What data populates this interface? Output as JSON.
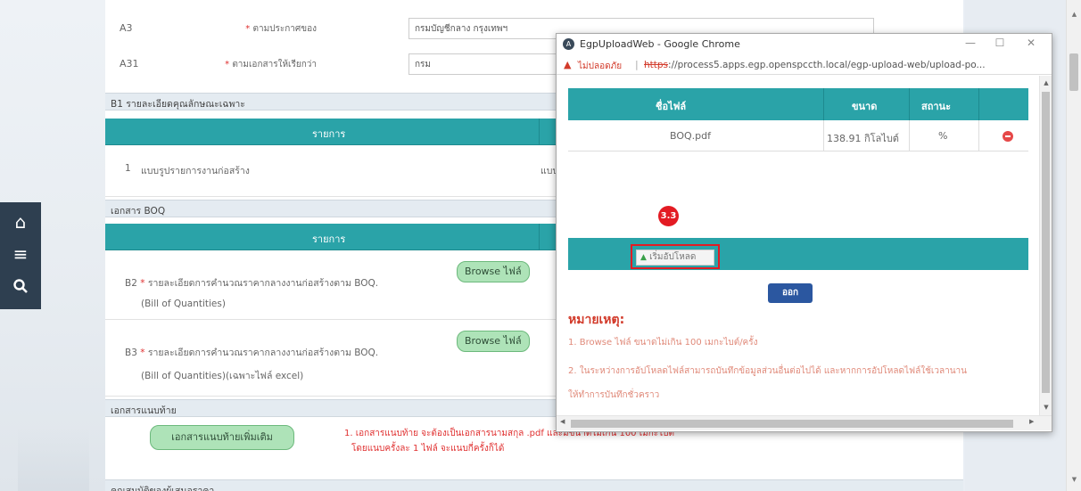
{
  "sidebar": {
    "icons": [
      "home-icon",
      "menu-icon",
      "search-icon"
    ]
  },
  "form": {
    "fields": [
      {
        "code": "A3",
        "label": "ตามประกาศของ",
        "value": "กรมบัญชีกลาง กรุงเทพฯ"
      },
      {
        "code": "A31",
        "label": "ตามเอกสารให้เรียกว่า",
        "value": "กรม"
      }
    ],
    "section_b1": "B1 รายละเอียดคุณลักษณะเฉพาะ",
    "table_header_item": "รายการ",
    "b1_row": {
      "num": "1",
      "text": "แบบรูปรายการงานก่อสร้าง",
      "right_text": "แบบ"
    },
    "section_boq": "เอกสาร BOQ",
    "boq_header_item": "รายการ",
    "b2": {
      "code": "B2",
      "text": "รายละเอียดการคำนวณราคากลางงานก่อสร้างตาม BOQ.",
      "sub": "(Bill of Quantities)",
      "browse": "Browse ไฟล์"
    },
    "b3": {
      "code": "B3",
      "text": "รายละเอียดการคำนวณราคากลางงานก่อสร้างตาม BOQ.",
      "sub": "(Bill of Quantities)(เฉพาะไฟล์ excel)",
      "browse": "Browse ไฟล์"
    },
    "section_attach": "เอกสารแนบท้าย",
    "attach_button": "เอกสารแนบท้ายเพิ่มเติม",
    "attach_note_line1": "1. เอกสารแนบท้าย จะต้องเป็นเอกสารนามสกุล .pdf และมีขนาดไม่เกิน 100 เมกะไบต์",
    "attach_note_line2": "โดยแนบครั้งละ 1 ไฟล์ จะแนบกี่ครั้งก็ได้",
    "section_next": "คุณสมบัติของผู้เสนอราคา"
  },
  "popup": {
    "window_title": "EgpUploadWeb - Google Chrome",
    "not_secure_label": "ไม่ปลอดภัย",
    "url_scheme": "https",
    "url_rest": "://process5.apps.egp.openspccth.local/egp-upload-web/upload-po...",
    "table": {
      "headers": {
        "filename": "ชื่อไฟล์",
        "size": "ขนาด",
        "status": "สถานะ"
      },
      "rows": [
        {
          "filename": "BOQ.pdf",
          "size": "138.91 กิโลไบต์",
          "status": "%"
        }
      ]
    },
    "step_badge": "3.3",
    "upload_button": "เริ่มอัปโหลด",
    "close_button": "ออก",
    "notes_title": "หมายเหตุ:",
    "notes": [
      "1. Browse ไฟล์ ขนาดไม่เกิน 100 เมกะไบต์/ครั้ง",
      "2. ในระหว่างการอัปโหลดไฟล์สามารถบันทึกข้อมูลส่วนอื่นต่อไปได้ และหากการอัปโหลดไฟล์ใช้เวลานาน",
      "ให้ทำการบันทึกชั่วคราว"
    ]
  },
  "colors": {
    "teal_header": "#2aa3a8",
    "browse_green": "#aee3b8",
    "highlight_red": "#e31b23",
    "close_blue": "#2b57a0",
    "sidebar_dark": "#2e3f50"
  }
}
